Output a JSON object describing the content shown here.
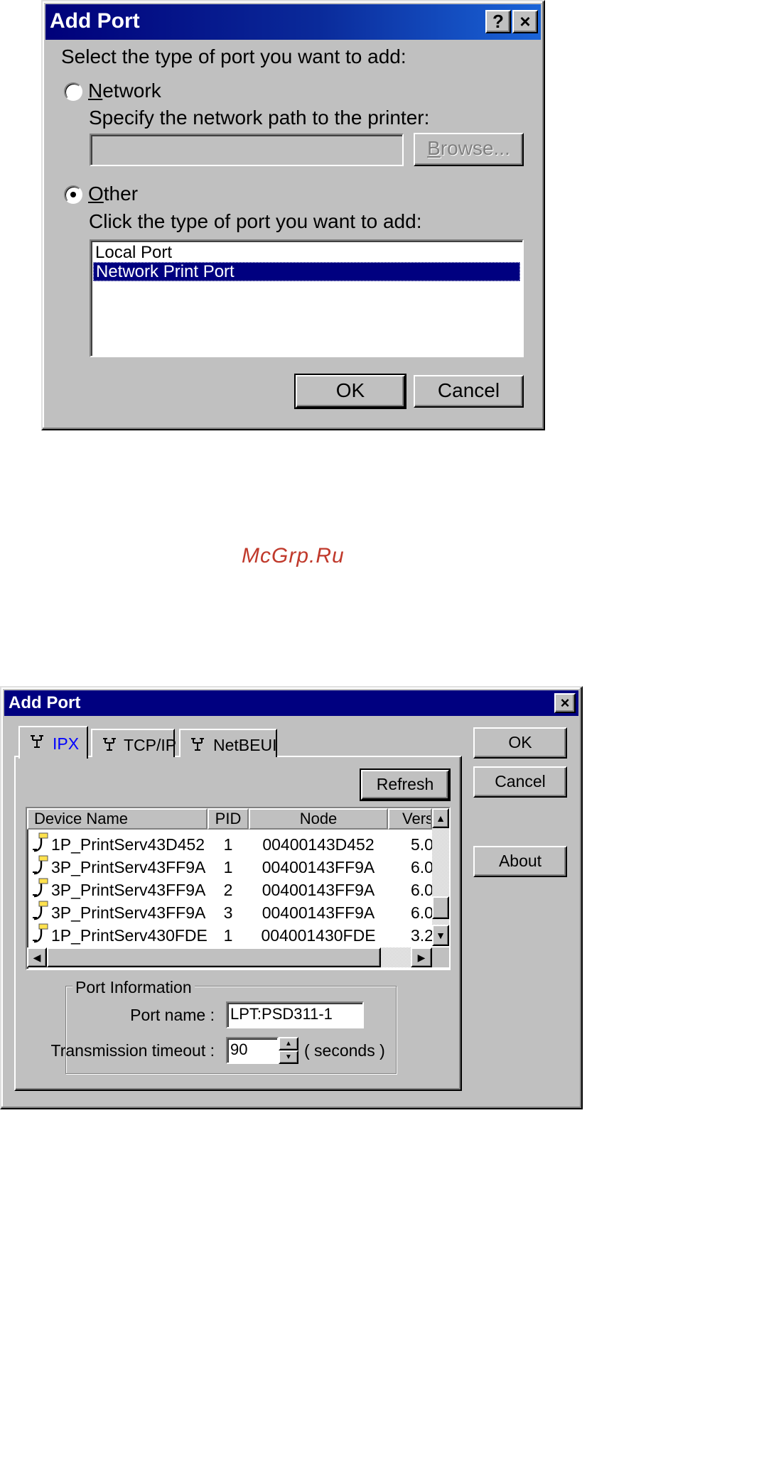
{
  "dialog1": {
    "title": "Add Port",
    "help_label": "?",
    "close_label": "×",
    "prompt": "Select the type of port you want to add:",
    "network": {
      "label_underlined": "N",
      "label_rest": "etwork",
      "selected": false,
      "path_prompt": "Specify the network path to the printer:",
      "path_value": "",
      "browse_underlined": "B",
      "browse_rest": "rowse..."
    },
    "other": {
      "label_underlined": "O",
      "label_rest": "ther",
      "selected": true,
      "list_prompt": "Click the type of port you want to add:",
      "items": [
        "Local Port",
        "Network Print Port"
      ],
      "selected_index": 1
    },
    "ok_label": "OK",
    "cancel_label": "Cancel"
  },
  "watermark": "McGrp.Ru",
  "dialog2": {
    "title": "Add Port",
    "close_label": "×",
    "tabs": [
      "IPX",
      "TCP/IP",
      "NetBEUI"
    ],
    "active_tab": 0,
    "refresh_label": "Refresh",
    "ok_label": "OK",
    "cancel_label": "Cancel",
    "about_label": "About",
    "columns": [
      "Device Name",
      "PID",
      "Node",
      "Vers"
    ],
    "rows": [
      {
        "name": "1P_PrintServ43D452",
        "pid": "1",
        "node": "00400143D452",
        "ver": "5.0"
      },
      {
        "name": "3P_PrintServ43FF9A",
        "pid": "1",
        "node": "00400143FF9A",
        "ver": "6.0"
      },
      {
        "name": "3P_PrintServ43FF9A",
        "pid": "2",
        "node": "00400143FF9A",
        "ver": "6.0"
      },
      {
        "name": "3P_PrintServ43FF9A",
        "pid": "3",
        "node": "00400143FF9A",
        "ver": "6.0"
      },
      {
        "name": "1P_PrintServ430FDE",
        "pid": "1",
        "node": "004001430FDE",
        "ver": "3.2"
      }
    ],
    "port_info": {
      "group_label": "Port Information",
      "port_name_label": "Port name :",
      "port_name_value": "LPT:PSD311-1",
      "timeout_label": "Transmission timeout :",
      "timeout_value": "90",
      "timeout_unit": "( seconds )"
    }
  },
  "colors": {
    "titlebar": "#00007a",
    "selection": "#000080",
    "watermark": "#c0392b",
    "face": "#c0c0c0"
  }
}
